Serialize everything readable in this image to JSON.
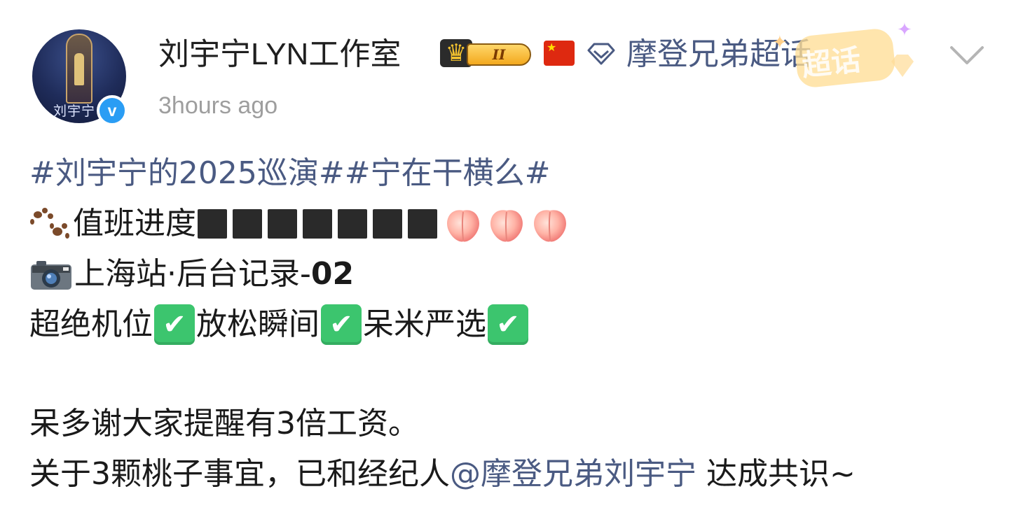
{
  "header": {
    "username": "刘宇宁LYN工作室",
    "avatar_signature": "刘宇宁",
    "verified_mark": "v",
    "level_badge": "II",
    "topic_link": "摩登兄弟超话",
    "super_topic_sticker": "超话",
    "timestamp": "3hours ago"
  },
  "post": {
    "hashtags": "#刘宇宁的2025巡演##宁在干横么#",
    "duty_label": "值班进度",
    "progress_blocks": 7,
    "peaches": 3,
    "record_label": "上海站·后台记录-",
    "record_number": "02",
    "highlights": [
      "超绝机位",
      "放松瞬间",
      "呆米严选"
    ],
    "thanks_line": "呆多谢大家提醒有3倍工资。",
    "consensus_prefix": "关于3颗桃子事宜，已和经纪人",
    "consensus_mention": "@摩登兄弟刘宇宁",
    "consensus_suffix": " 达成共识~"
  },
  "icons": {
    "avatar_verified": "verified-icon",
    "crown": "crown-icon",
    "flag": "china-flag-icon",
    "topic": "diamond-icon",
    "menu": "chevron-down-icon",
    "paws": "paws-icon",
    "camera": "camera-icon",
    "peach": "peach-icon",
    "check": "check-mark-icon"
  },
  "colors": {
    "link": "#4a5a82",
    "timestamp": "#9e9e9e",
    "verified": "#2a9df4",
    "check": "#3cc56e"
  }
}
